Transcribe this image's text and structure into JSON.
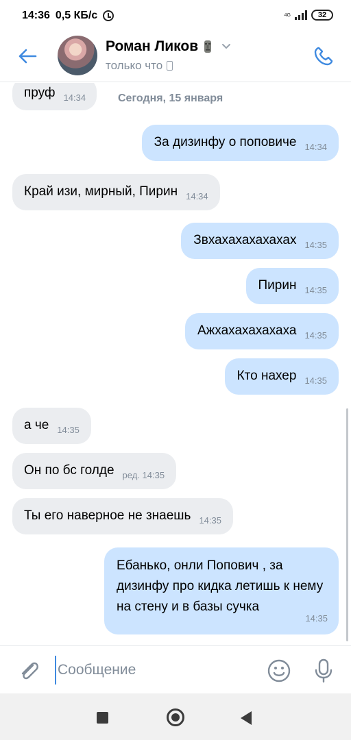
{
  "status_bar": {
    "time": "14:36",
    "speed": "0,5 КБ/с",
    "network": "4G",
    "battery": "32"
  },
  "header": {
    "contact_name": "Роман Ликов",
    "status": "только что"
  },
  "chat": {
    "date_label": "Сегодня, 15 января",
    "messages": [
      {
        "dir": "in",
        "text": "пруф",
        "time": "14:34"
      },
      {
        "dir": "out",
        "text": "За дизинфу о поповиче",
        "time": "14:34"
      },
      {
        "dir": "in",
        "text": "Край изи, мирный, Пирин",
        "time": "14:34"
      },
      {
        "dir": "out",
        "text": "Звхахахахахахах",
        "time": "14:35"
      },
      {
        "dir": "out",
        "text": "Пирин",
        "time": "14:35"
      },
      {
        "dir": "out",
        "text": "Ажхахахахахаха",
        "time": "14:35"
      },
      {
        "dir": "out",
        "text": "Кто нахер",
        "time": "14:35"
      },
      {
        "dir": "in",
        "text": "а че",
        "time": "14:35"
      },
      {
        "dir": "in",
        "text": "Он по бс голде",
        "time": "ред. 14:35"
      },
      {
        "dir": "in",
        "text": "Ты его наверное не знаешь",
        "time": "14:35"
      },
      {
        "dir": "out",
        "text": "Ебанько, онли Попович , за дизинфу про кидка летишь к нему на стену и в базы сучка",
        "time": "14:35"
      }
    ]
  },
  "composer": {
    "placeholder": "Сообщение"
  },
  "colors": {
    "accent": "#3f8ae0",
    "incoming_bubble": "#ebedf0",
    "outgoing_bubble": "#cce4ff",
    "secondary_text": "#818c99"
  }
}
